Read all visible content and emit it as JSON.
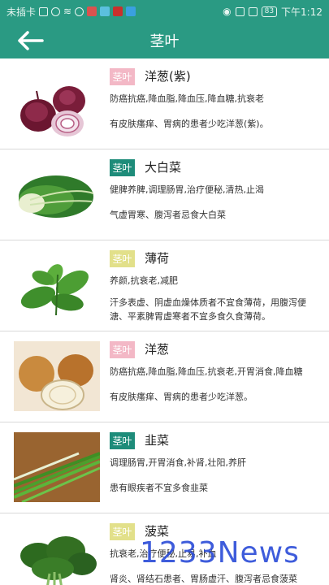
{
  "status_bar": {
    "left_text": "未插卡",
    "battery": "83",
    "time": "下午1:12",
    "icons": [
      "sim-card-icon",
      "hotspot-icon",
      "wifi-icon",
      "data-saver-icon",
      "app-icon",
      "app-icon",
      "app-icon",
      "app-icon",
      "eye-icon",
      "nfc-icon",
      "vibrate-icon",
      "battery-icon"
    ]
  },
  "header": {
    "title": "茎叶",
    "back_icon": "arrow-left-icon"
  },
  "colors": {
    "primary": "#2a9a83",
    "tag_pink": "#f3b8c6",
    "tag_teal": "#1e8c7a",
    "tag_yellow": "#e2e08a"
  },
  "items": [
    {
      "tag": "茎叶",
      "name": "洋葱(紫)",
      "effects": "防癌抗癌,降血脂,降血压,降血糖,抗衰老",
      "warning": "有皮肤瘙痒、胃病的患者少吃洋葱(紫)。",
      "image": "red-onion"
    },
    {
      "tag": "茎叶",
      "name": "大白菜",
      "effects": "健脾养脾,调理肠胃,治疗便秘,清热,止渴",
      "warning": "气虚胃寒、腹泻者忌食大白菜",
      "image": "napa-cabbage"
    },
    {
      "tag": "茎叶",
      "name": "薄荷",
      "effects": "养颜,抗衰老,减肥",
      "warning": "汗多表虚、阴虚血燥体质者不宜食薄荷，用腹泻便溏、平素脾胃虚寒者不宜多食久食薄荷。",
      "image": "mint"
    },
    {
      "tag": "茎叶",
      "name": "洋葱",
      "effects": "防癌抗癌,降血脂,降血压,抗衰老,开胃消食,降血糖",
      "warning": "有皮肤瘙痒、胃病的患者少吃洋葱。",
      "image": "onion"
    },
    {
      "tag": "茎叶",
      "name": "韭菜",
      "effects": "调理肠胃,开胃消食,补肾,壮阳,养肝",
      "warning": "患有眼疾者不宜多食韭菜",
      "image": "chives"
    },
    {
      "tag": "茎叶",
      "name": "菠菜",
      "effects": "抗衰老,治疗便秘,止易,补血",
      "warning": "肾炎、肾结石患者、胃肠虚汗、腹泻者忌食菠菜",
      "image": "spinach"
    }
  ],
  "watermark": "1233News"
}
